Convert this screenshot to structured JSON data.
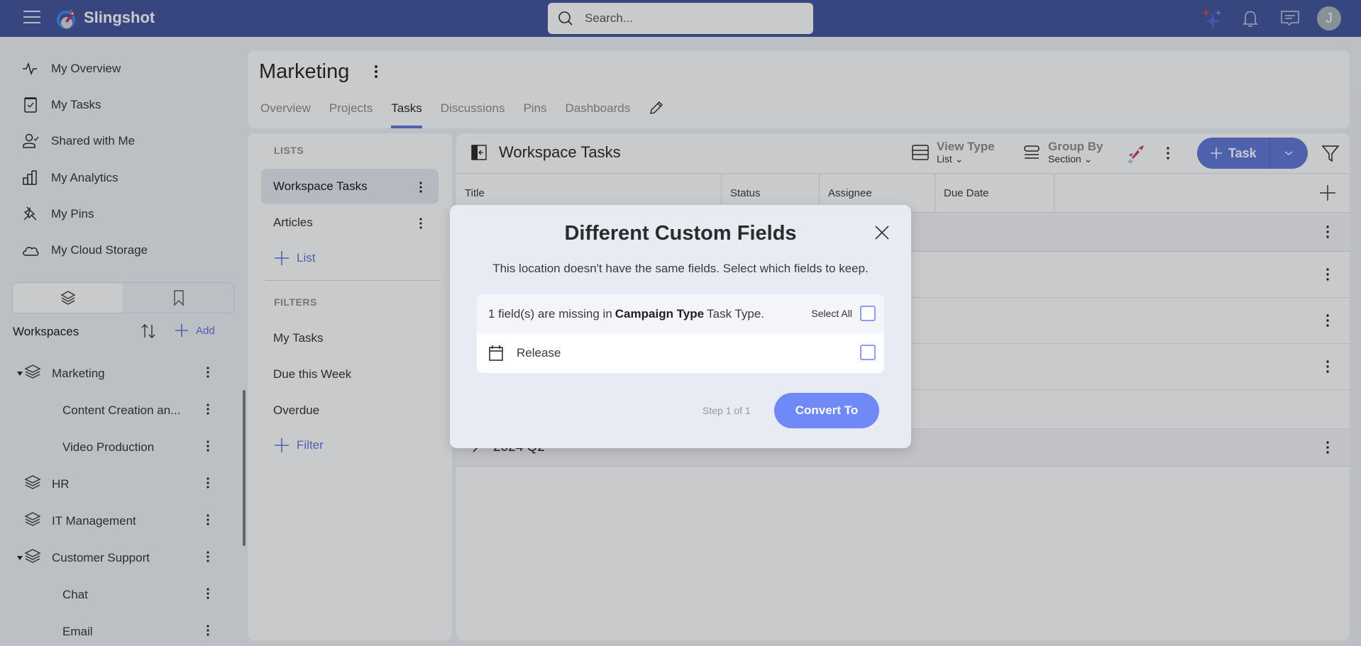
{
  "app": {
    "brand": "Slingshot",
    "search_placeholder": "Search...",
    "avatar_initial": "J",
    "colors": {
      "topbar": "#3e4f9a",
      "accent": "#5c73d6",
      "convert_button": "#6f8af7"
    }
  },
  "sidebar": {
    "nav": [
      {
        "label": "My Overview",
        "icon": "activity-icon"
      },
      {
        "label": "My Tasks",
        "icon": "clipboard-check-icon"
      },
      {
        "label": "Shared with Me",
        "icon": "user-check-icon"
      },
      {
        "label": "My Analytics",
        "icon": "bar-chart-icon"
      },
      {
        "label": "My Pins",
        "icon": "pin-icon"
      },
      {
        "label": "My Cloud Storage",
        "icon": "cloud-icon"
      }
    ],
    "toggle": {
      "active": "workspaces",
      "options": [
        "workspaces",
        "bookmarks"
      ]
    },
    "workspaces_label": "Workspaces",
    "add_label": "Add",
    "workspaces": [
      {
        "label": "Marketing",
        "level": 0,
        "expanded": true
      },
      {
        "label": "Content Creation an...",
        "level": 1
      },
      {
        "label": "Video Production",
        "level": 1
      },
      {
        "label": "HR",
        "level": 0,
        "expanded": false
      },
      {
        "label": "IT Management",
        "level": 0,
        "expanded": false
      },
      {
        "label": "Customer Support",
        "level": 0,
        "expanded": true
      },
      {
        "label": "Chat",
        "level": 1
      },
      {
        "label": "Email",
        "level": 1
      }
    ]
  },
  "workspace": {
    "title": "Marketing",
    "tabs": [
      {
        "label": "Overview",
        "active": false
      },
      {
        "label": "Projects",
        "active": false
      },
      {
        "label": "Tasks",
        "active": true
      },
      {
        "label": "Discussions",
        "active": false
      },
      {
        "label": "Pins",
        "active": false
      },
      {
        "label": "Dashboards",
        "active": false
      }
    ]
  },
  "lists_panel": {
    "lists_label": "LISTS",
    "lists": [
      {
        "label": "Workspace Tasks",
        "active": true
      },
      {
        "label": "Articles",
        "active": false
      }
    ],
    "add_list_label": "List",
    "filters_label": "FILTERS",
    "filters": [
      "My Tasks",
      "Due this Week",
      "Overdue"
    ],
    "add_filter_label": "Filter"
  },
  "tasks_panel": {
    "title": "Workspace Tasks",
    "view_type": {
      "label": "View Type",
      "value": "List"
    },
    "group_by": {
      "label": "Group By",
      "value": "Section"
    },
    "task_button_label": "Task",
    "columns": [
      "Title",
      "Status",
      "Assignee",
      "Due Date"
    ],
    "visible_group_label": "2024 Q2"
  },
  "modal": {
    "title": "Different Custom Fields",
    "subtitle": "This location doesn't have the same fields. Select which fields to keep.",
    "missing_prefix": "1 field(s) are missing in",
    "task_type": "Campaign Type",
    "missing_suffix": "Task Type.",
    "select_all_label": "Select All",
    "select_all_checked": false,
    "fields": [
      {
        "label": "Release",
        "icon": "calendar-icon",
        "checked": false
      }
    ],
    "step_text": "Step 1 of 1",
    "convert_label": "Convert To"
  }
}
